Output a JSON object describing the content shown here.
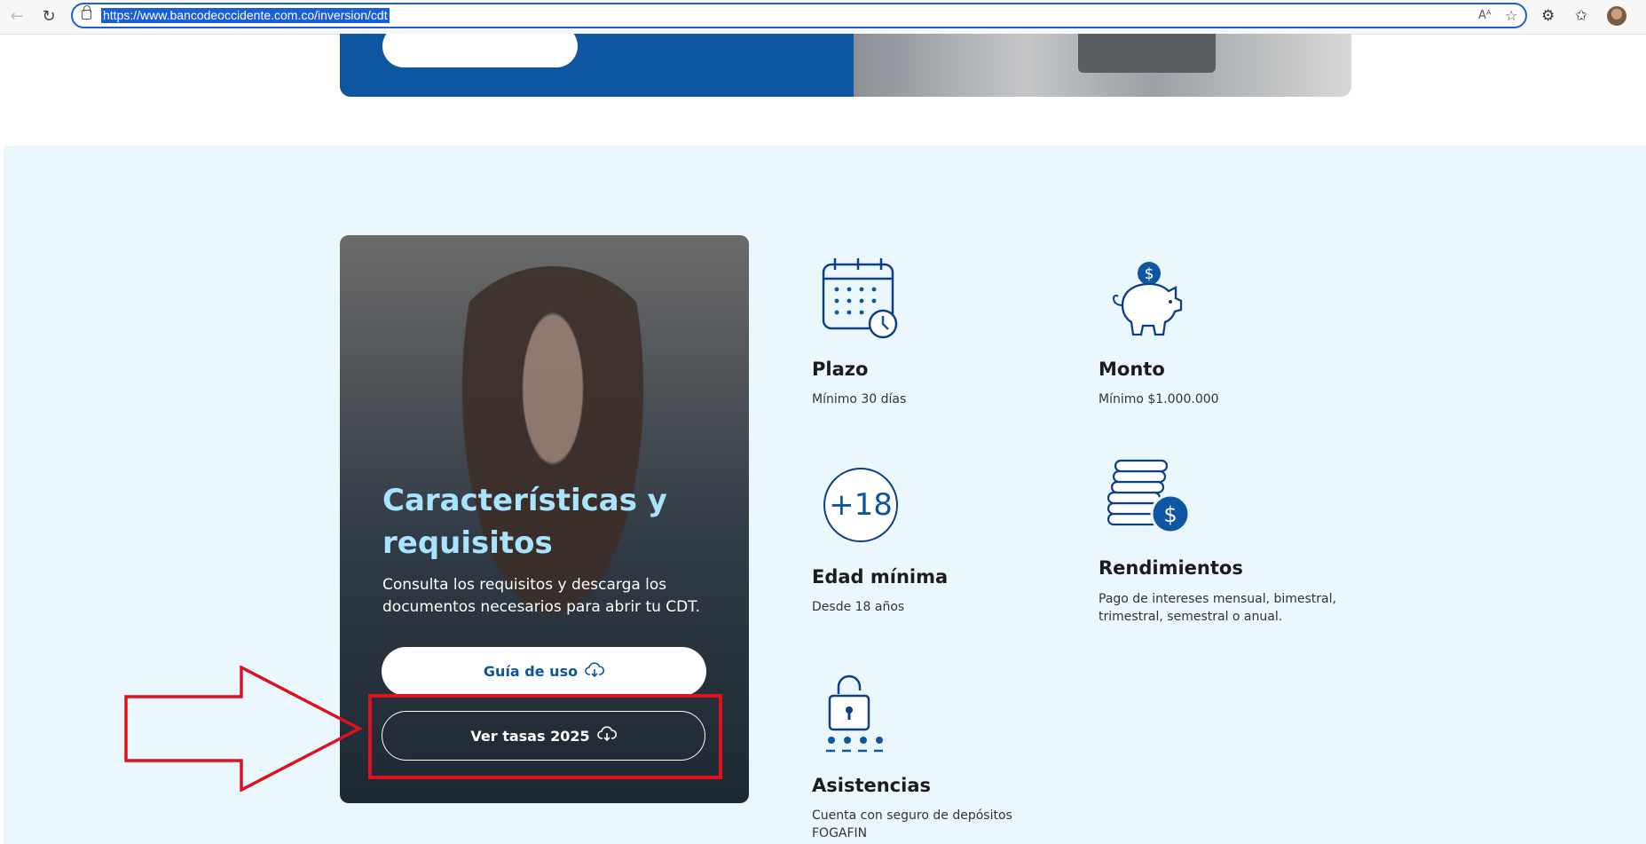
{
  "browser": {
    "url": "https://www.bancodeoccidente.com.co/inversion/cdt"
  },
  "colors": {
    "brand_blue": "#0e56a1",
    "section_bg": "#eaf8fe",
    "card_title": "#a9e4ff",
    "highlight_red": "#e0101e"
  },
  "card": {
    "title": "Características y requisitos",
    "description": "Consulta los requisitos y descarga los documentos necesarios para abrir tu CDT.",
    "guide_button": "Guía de uso",
    "rates_button": "Ver tasas 2025"
  },
  "features": [
    {
      "icon": "calendar-clock-icon",
      "title": "Plazo",
      "desc": "Mínimo 30 días"
    },
    {
      "icon": "piggy-bank-icon",
      "title": "Monto",
      "desc": "Mínimo $1.000.000"
    },
    {
      "icon": "age-18-icon",
      "title": "Edad mínima",
      "desc": "Desde 18 años",
      "badge": "+18"
    },
    {
      "icon": "coins-stack-icon",
      "title": "Rendimientos",
      "desc": "Pago de intereses mensual, bimestral, trimestral, semestral o anual."
    },
    {
      "icon": "padlock-icon",
      "title": "Asistencias",
      "desc": "Cuenta con seguro de depósitos FOGAFIN"
    }
  ]
}
